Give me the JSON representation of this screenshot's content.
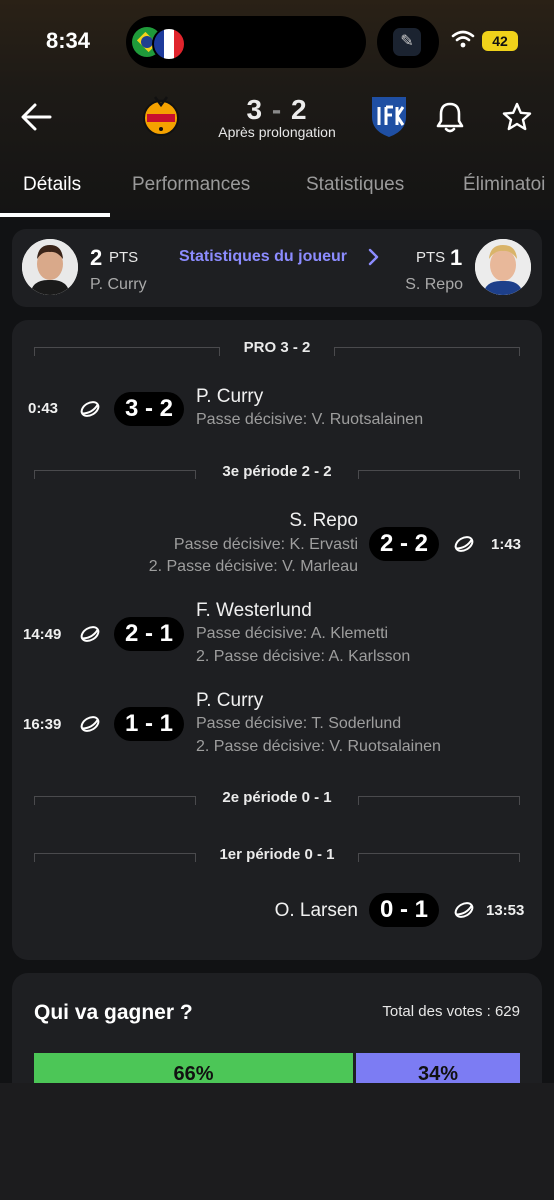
{
  "status_bar": {
    "time": "8:34",
    "battery": "42"
  },
  "match": {
    "home_score": "3",
    "separator": "-",
    "away_score": "2",
    "subtitle": "Après prolongation"
  },
  "tabs": [
    {
      "label": "Détails",
      "active": true
    },
    {
      "label": "Performances"
    },
    {
      "label": "Statistiques"
    },
    {
      "label": "Éliminatoi"
    }
  ],
  "player_stats": {
    "left": {
      "points": "2",
      "label": "PTS",
      "name": "P. Curry"
    },
    "link": "Statistiques du joueur",
    "right": {
      "points": "1",
      "label": "PTS",
      "name": "S. Repo"
    }
  },
  "periods": {
    "pro": "PRO 3 - 2",
    "third": "3e période 2 - 2",
    "second": "2e période 0 - 1",
    "first": "1er période 0 - 1"
  },
  "goals": [
    {
      "time": "0:43",
      "score": "3 - 2",
      "scorer": "P. Curry",
      "assist1": "Passe décisive: V. Ruotsalainen",
      "side": "home"
    },
    {
      "time": "1:43",
      "score": "2 - 2",
      "scorer": "S. Repo",
      "assist1": "Passe décisive: K. Ervasti",
      "assist2": "2. Passe décisive: V. Marleau",
      "side": "away"
    },
    {
      "time": "14:49",
      "score": "2 - 1",
      "scorer": "F. Westerlund",
      "assist1": "Passe décisive: A. Klemetti",
      "assist2": "2. Passe décisive: A. Karlsson",
      "side": "home"
    },
    {
      "time": "16:39",
      "score": "1 - 1",
      "scorer": "P. Curry",
      "assist1": "Passe décisive: T. Soderlund",
      "assist2": "2. Passe décisive: V. Ruotsalainen",
      "side": "home"
    },
    {
      "time": "13:53",
      "score": "0 - 1",
      "scorer": "O. Larsen",
      "side": "away"
    }
  ],
  "poll": {
    "title": "Qui va gagner ?",
    "total": "Total des votes : 629",
    "home_pct": "66%",
    "away_pct": "34%",
    "home_share": 0.66,
    "away_share": 0.34,
    "home_color": "#4cc657",
    "away_color": "#7c7cf3"
  },
  "icons": {
    "back": "arrow-left-icon",
    "bell": "bell-icon",
    "star": "star-icon",
    "puck": "hockey-puck-icon",
    "chevron": "chevron-right-icon"
  }
}
